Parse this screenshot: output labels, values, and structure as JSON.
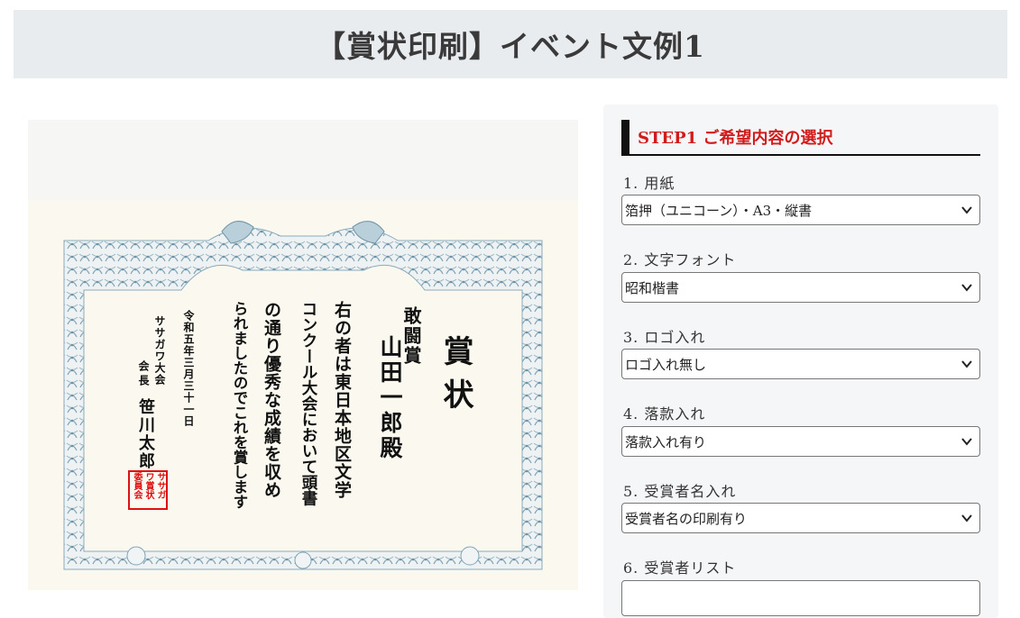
{
  "page": {
    "title": "【賞状印刷】イベント文例1"
  },
  "certificate": {
    "heading": "賞状",
    "award": "敢闘賞",
    "recipient": "山田一郎殿",
    "body_lines": [
      "右の者は東日本地区文学",
      "コンクール大会において頭書",
      "の通り優秀な成績を収め",
      "られましたのでこれを賞します"
    ],
    "date": "令和五年三月三十一日",
    "org": "ササガワ大会",
    "signer_title": "会長",
    "signer_name": "笹川太郎",
    "seal_cols": [
      "ササガ",
      "ワ賞状",
      "委員会"
    ]
  },
  "form": {
    "step_title": "STEP1 ご希望内容の選択",
    "fields": [
      {
        "label": "1. 用紙",
        "value": "箔押（ユニコーン）・A3・縦書"
      },
      {
        "label": "2. 文字フォント",
        "value": "昭和楷書"
      },
      {
        "label": "3. ロゴ入れ",
        "value": "ロゴ入れ無し"
      },
      {
        "label": "4. 落款入れ",
        "value": "落款入れ有り"
      },
      {
        "label": "5. 受賞者名入れ",
        "value": "受賞者名の印刷有り"
      }
    ],
    "list_label": "6. 受賞者リスト",
    "list_value": ""
  },
  "colors": {
    "accent_red": "#d21c1c",
    "header_bg": "#e9ecef",
    "panel_bg": "#f5f6f8",
    "frame_blue": "#7fa3b5"
  },
  "icons": {
    "select_arrow": "chevron-down-icon"
  }
}
